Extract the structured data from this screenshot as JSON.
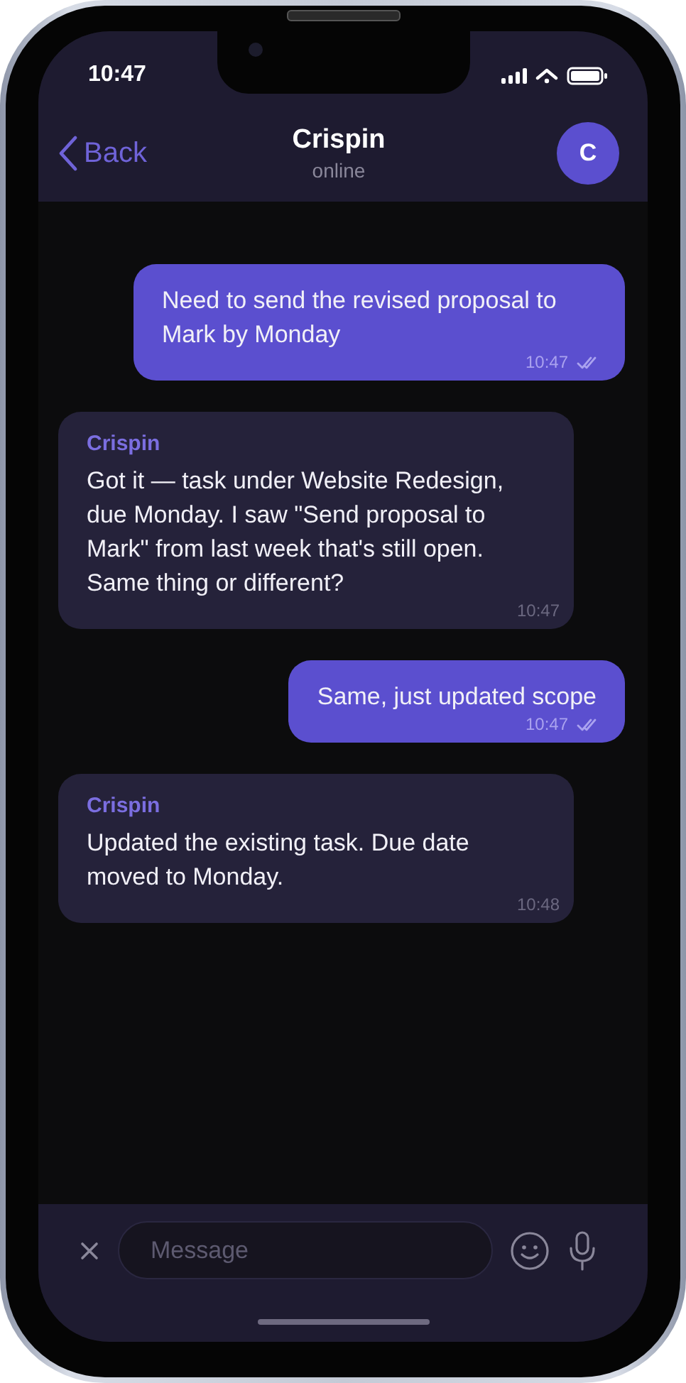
{
  "status_bar": {
    "time": "10:47"
  },
  "header": {
    "back_label": "Back",
    "title": "Crispin",
    "subtitle": "online",
    "avatar_initial": "C"
  },
  "messages": [
    {
      "kind": "outgoing",
      "text": "Need to send the revised proposal to Mark by Monday",
      "time": "10:47",
      "read": true
    },
    {
      "kind": "incoming",
      "sender": "Crispin",
      "text": "Got it — task under Website Redesign, due Monday. I saw \"Send proposal to Mark\" from last week that's still open. Same thing or different?",
      "time": "10:47"
    },
    {
      "kind": "outgoing",
      "text": "Same, just updated scope",
      "time": "10:47",
      "read": true
    },
    {
      "kind": "incoming",
      "sender": "Crispin",
      "text": "Updated the existing task. Due date moved to Monday.",
      "time": "10:48"
    }
  ],
  "composer": {
    "placeholder": "Message"
  }
}
